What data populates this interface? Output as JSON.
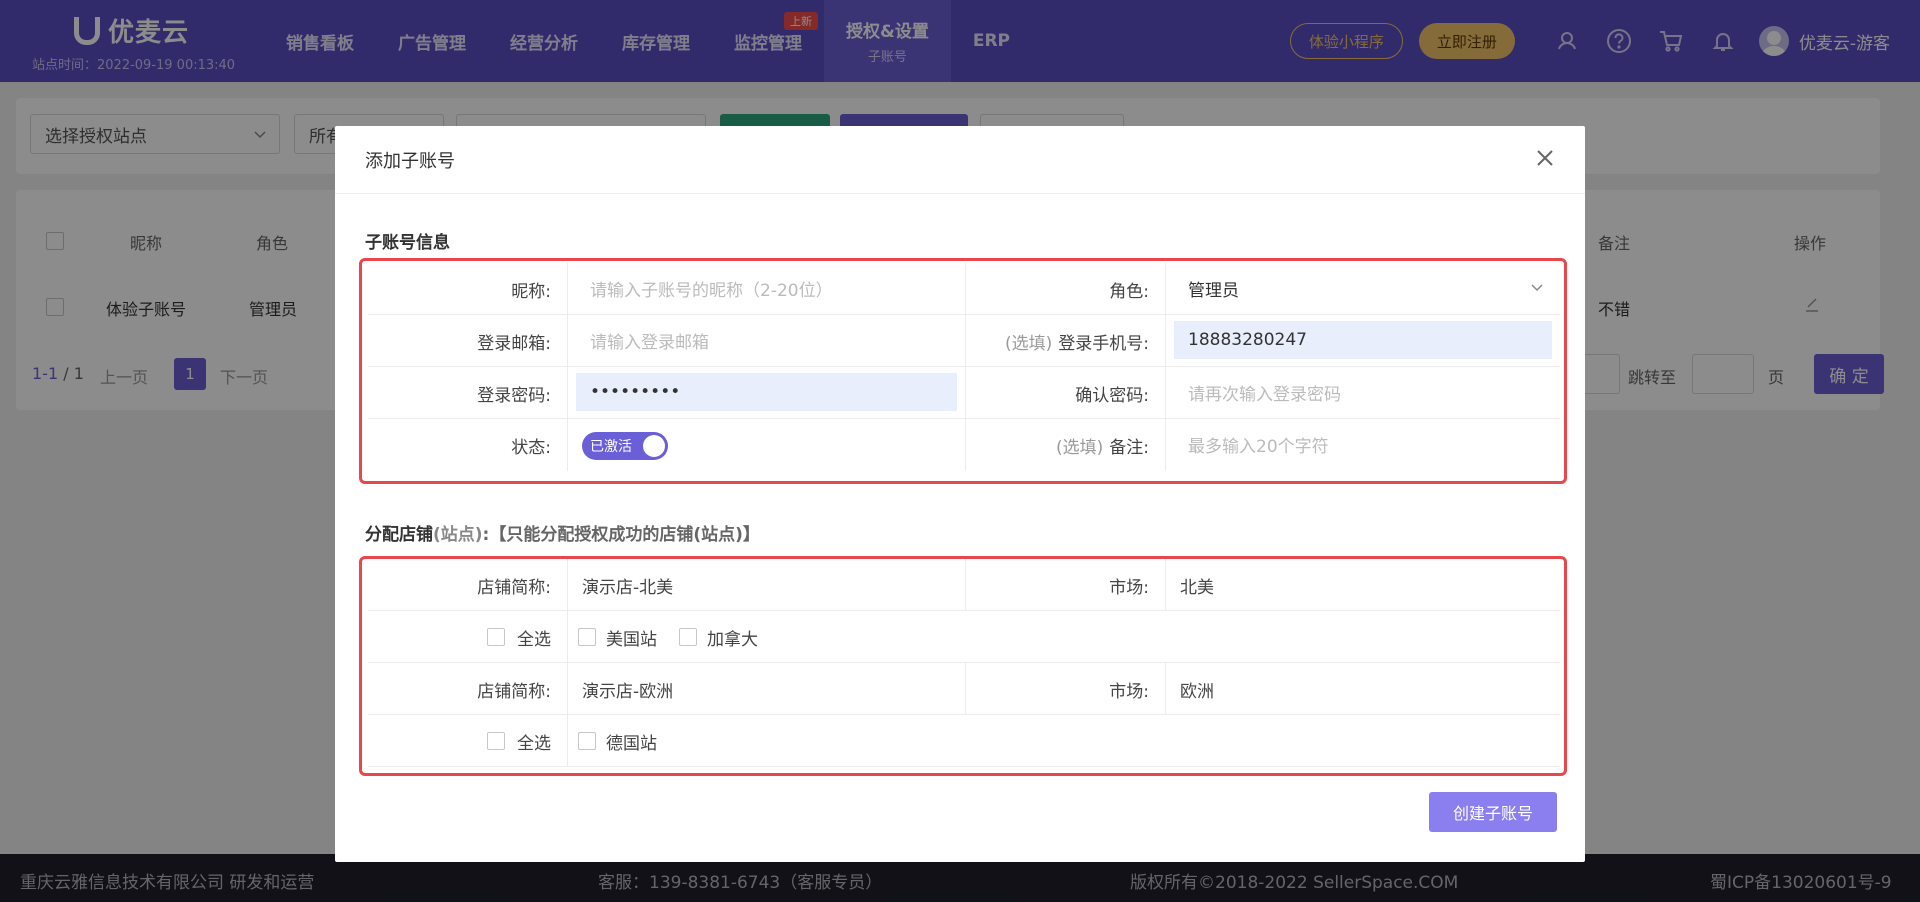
{
  "app": {
    "logo_text": "优麦云",
    "site_time": "站点时间：2022-09-19 00:13:40"
  },
  "nav": {
    "items": [
      {
        "label": "销售看板"
      },
      {
        "label": "广告管理"
      },
      {
        "label": "经营分析"
      },
      {
        "label": "库存管理"
      },
      {
        "label": "监控管理",
        "badge": "上新"
      },
      {
        "label": "授权&设置",
        "sub": "子账号",
        "active": true
      },
      {
        "label": "ERP"
      }
    ],
    "mini_program": "体验小程序",
    "register": "立即注册",
    "user": "优麦云-游客",
    "icons": [
      "headset-icon",
      "help-icon",
      "cart-icon",
      "bell-icon"
    ]
  },
  "page": {
    "filter_site": "选择授权站点",
    "filter_second": "所有",
    "table_headers": [
      "昵称",
      "角色",
      "备注",
      "操作"
    ],
    "row": {
      "nickname": "体验子账号",
      "role": "管理员",
      "note": "不错"
    },
    "pager": {
      "range": "1-1",
      "total": "/ 1",
      "prev": "上一页",
      "current": "1",
      "next": "下一页",
      "jump_to": "跳转至",
      "page_unit": "页",
      "confirm": "确 定"
    }
  },
  "footer": {
    "company": "重庆云雅信息技术有限公司 研发和运营",
    "service": "客服：139-8381-6743（客服专员）",
    "copyright": "版权所有©2018-2022 SellerSpace.COM",
    "icp": "蜀ICP备13020601号-9"
  },
  "modal": {
    "title": "添加子账号",
    "section1_title": "子账号信息",
    "fields": {
      "nickname_label": "昵称:",
      "nickname_placeholder": "请输入子账号的昵称（2-20位）",
      "role_label": "角色:",
      "role_value": "管理员",
      "email_label": "登录邮箱:",
      "email_placeholder": "请输入登录邮箱",
      "phone_optional": "(选填)",
      "phone_label": "登录手机号:",
      "phone_value": "18883280247",
      "password_label": "登录密码:",
      "password_value": "•••••••••",
      "confirm_label": "确认密码:",
      "confirm_placeholder": "请再次输入登录密码",
      "status_label": "状态:",
      "status_value": "已激活",
      "note_optional": "(选填)",
      "note_label": "备注:",
      "note_placeholder": "最多输入20个字符"
    },
    "section2_title": "分配店铺",
    "section2_sub": "(站点)",
    "section2_note": ":【只能分配授权成功的店铺(站点)】",
    "stores": [
      {
        "name_label": "店铺简称:",
        "name": "演示店-北美",
        "market_label": "市场:",
        "market": "北美",
        "select_all": "全选",
        "sites": [
          "美国站",
          "加拿大"
        ]
      },
      {
        "name_label": "店铺简称:",
        "name": "演示店-欧洲",
        "market_label": "市场:",
        "market": "欧洲",
        "select_all": "全选",
        "sites": [
          "德国站"
        ]
      }
    ],
    "create_button": "创建子账号"
  }
}
